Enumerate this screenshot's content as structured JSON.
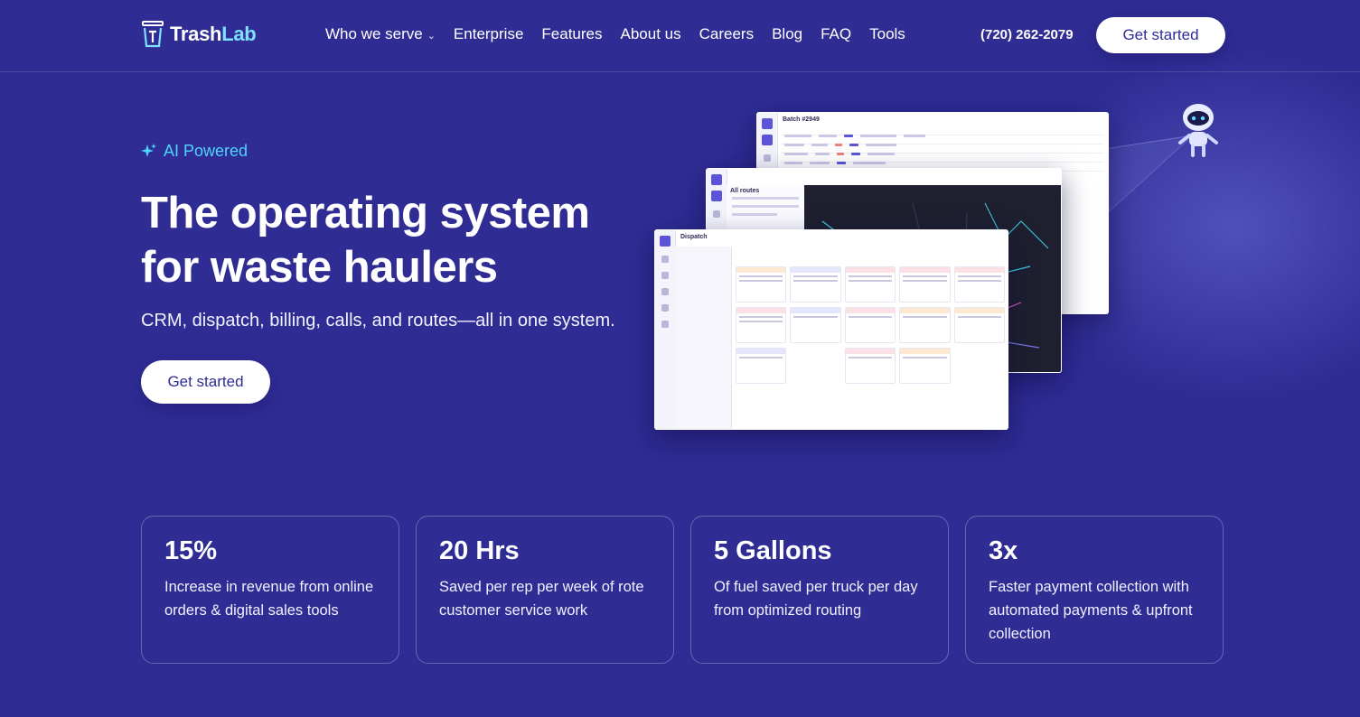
{
  "brand": {
    "name_part1": "Trash",
    "name_part2": "Lab"
  },
  "nav": {
    "items": [
      {
        "label": "Who we serve",
        "has_dropdown": true
      },
      {
        "label": "Enterprise"
      },
      {
        "label": "Features"
      },
      {
        "label": "About us"
      },
      {
        "label": "Careers"
      },
      {
        "label": "Blog"
      },
      {
        "label": "FAQ"
      },
      {
        "label": "Tools"
      }
    ],
    "phone": "(720) 262-2079",
    "cta_label": "Get started"
  },
  "hero": {
    "badge_label": "AI Powered",
    "title_line1": "The operating system",
    "title_line2": "for waste haulers",
    "subtitle": "CRM, dispatch, billing, calls, and routes—all in one system.",
    "cta_label": "Get started"
  },
  "mockups": {
    "batch_title": "Batch #2949",
    "routes_title": "All routes",
    "dispatch_title": "Dispatch"
  },
  "stats": [
    {
      "value": "15%",
      "description": "Increase in revenue from online orders & digital sales tools"
    },
    {
      "value": "20 Hrs",
      "description": "Saved per rep per week of rote customer service work"
    },
    {
      "value": "5 Gallons",
      "description": "Of fuel saved per truck per day from optimized routing"
    },
    {
      "value": "3x",
      "description": "Faster payment collection with automated payments & upfront collection"
    }
  ],
  "colors": {
    "background": "#2f2c94",
    "accent_cyan": "#4fd3ff",
    "button_text": "#2f2c94"
  }
}
